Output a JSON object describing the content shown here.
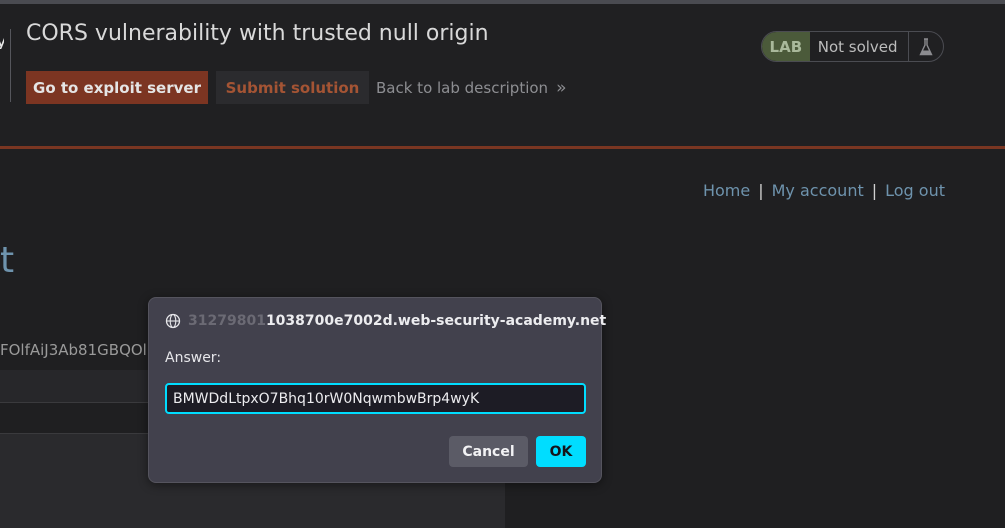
{
  "lab_header": {
    "title": "CORS vulnerability with trusted null origin",
    "exploit_button_label": "Go to exploit server",
    "submit_button_label": "Submit solution",
    "back_link_label": "Back to lab description",
    "status_tag": "LAB",
    "status_text": "Not solved",
    "status_icon": "flask-icon"
  },
  "nav": {
    "items": [
      "Home",
      "My account",
      "Log out"
    ],
    "separator": "|"
  },
  "background": {
    "heading_fragment": "t",
    "api_key_fragment": "FOlfAiJ3Ab81GBQOl"
  },
  "dialog": {
    "origin_prefix": "31279801",
    "origin_main": "1038700e7002d.web-security-academy.net",
    "label": "Answer:",
    "input_value": "BMWDdLtpxO7Bhq10rW0NqwmbwBrp4wyK",
    "cancel_label": "Cancel",
    "ok_label": "OK"
  },
  "colors": {
    "background": "#1f1f21",
    "accent_orange": "#7c3522",
    "link_blue": "#6e93ad",
    "dialog_bg": "#42414d",
    "focus_cyan": "#00ddff"
  }
}
